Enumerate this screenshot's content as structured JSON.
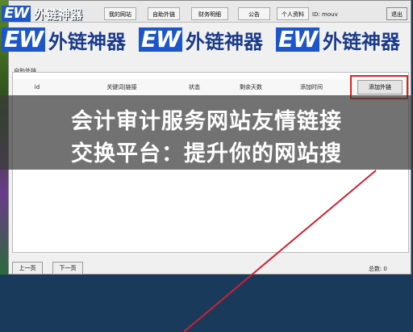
{
  "window": {
    "tabs": [
      "我的网站",
      "自助外链",
      "财务明细",
      "公告",
      "个人资料"
    ],
    "id_label": "ID: mouv",
    "exit_label": "退出"
  },
  "watermark": {
    "logo": "EW",
    "text": "外链神器"
  },
  "section": {
    "title": "自助外链"
  },
  "table": {
    "columns": [
      "id",
      "关键词|链接",
      "状态",
      "剩余天数",
      "添加时间"
    ],
    "add_button": "添加外链"
  },
  "banner": {
    "line1": "会计审计服务网站友情链接",
    "line2": "交换平台：提升你的网站搜"
  },
  "pager": {
    "prev": "上一页",
    "next": "下一页",
    "total_label": "总数:",
    "total_value": "0"
  },
  "colors": {
    "accent": "#1d56c8",
    "highlight": "#e02020"
  }
}
